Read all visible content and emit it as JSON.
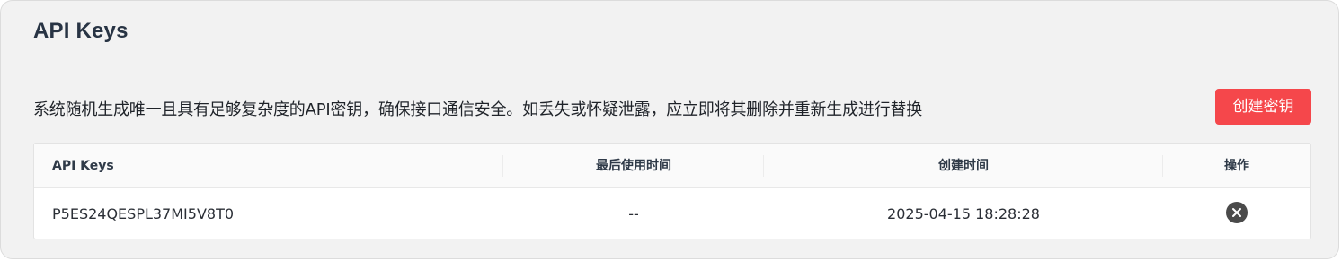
{
  "panel": {
    "title": "API Keys",
    "description": "系统随机生成唯一且具有足够复杂度的API密钥，确保接口通信安全。如丢失或怀疑泄露，应立即将其删除并重新生成进行替换",
    "create_button_label": "创建密钥",
    "accent_color": "#f5474b"
  },
  "table": {
    "columns": [
      "API Keys",
      "最后使用时间",
      "创建时间",
      "操作"
    ],
    "rows": [
      {
        "key": "P5ES24QESPL37MI5V8T0",
        "last_used": "--",
        "created": "2025-04-15 18:28:28",
        "action_icon": "close-circle-icon"
      }
    ]
  }
}
